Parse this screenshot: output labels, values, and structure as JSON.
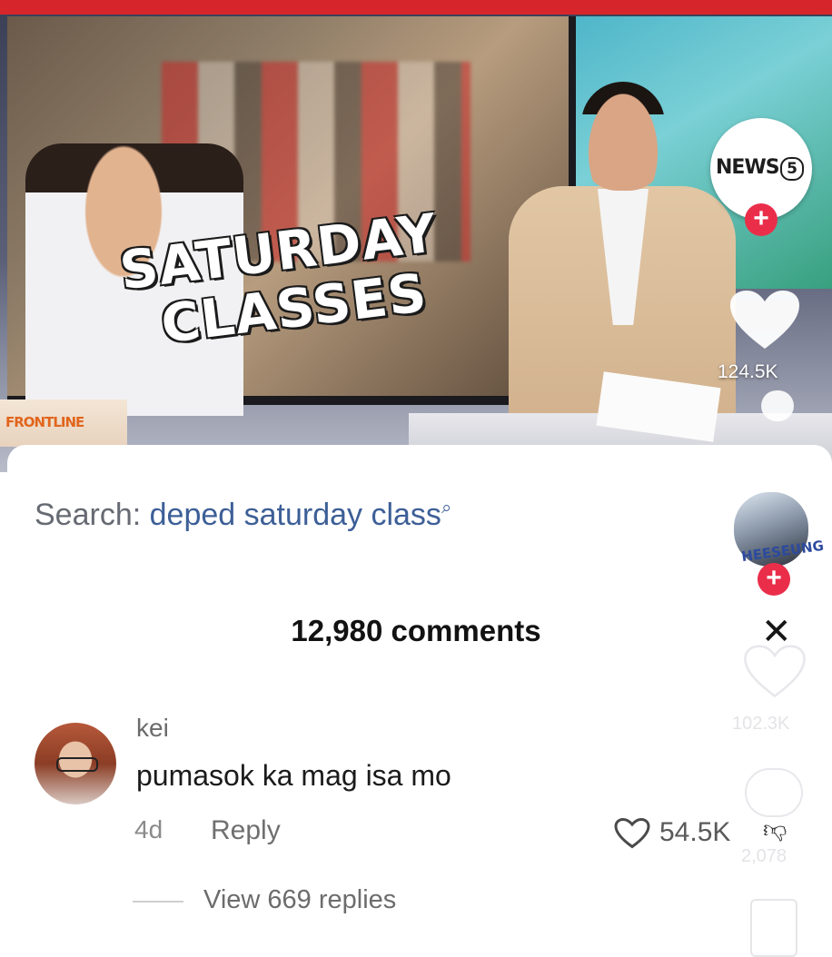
{
  "video": {
    "headline_line1": "SATURDAY",
    "headline_line2": "CLASSES",
    "program_logo_text": "FRONTLINE",
    "channel_logo_text": "NEWS",
    "channel_logo_number": "5",
    "like_count": "124.5K"
  },
  "search": {
    "prefix": "Search: ",
    "query": "deped saturday class",
    "search_glyph": "ᵐ"
  },
  "comments_panel": {
    "title": "12,980 comments",
    "close_glyph": "✕",
    "side_profile_name": "HEESEUNG",
    "side_like_count": "102.3K",
    "side_comment_count": "2,078",
    "comment": {
      "username": "kei",
      "text": "pumasok ka mag isa mo",
      "age": "4d",
      "reply_label": "Reply",
      "like_count": "54.5K",
      "view_replies_label": "View 669 replies"
    }
  },
  "colors": {
    "brand_red": "#d7262b",
    "follow_badge": "#ea2e4a",
    "search_query": "#3d5f97"
  },
  "icons": [
    "plus-icon",
    "heart-icon",
    "close-icon",
    "search-icon",
    "dislike-icon",
    "comment-icon",
    "bookmark-icon"
  ]
}
